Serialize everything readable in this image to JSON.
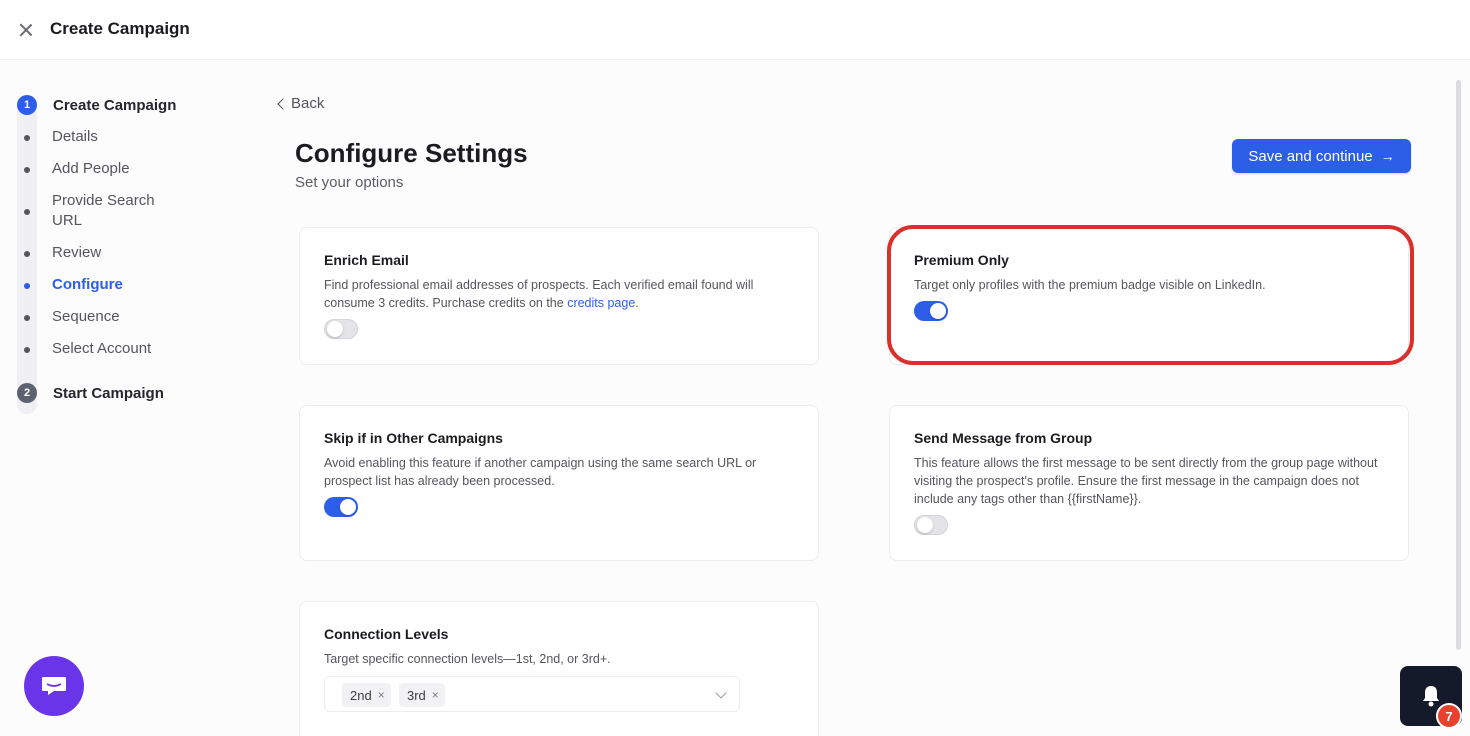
{
  "header": {
    "title": "Create Campaign"
  },
  "stepper": {
    "step1": {
      "number": "1",
      "label": "Create Campaign"
    },
    "step2": {
      "number": "2",
      "label": "Start Campaign"
    },
    "substeps": [
      {
        "label": "Details"
      },
      {
        "label": "Add People"
      },
      {
        "label": "Provide Search URL"
      },
      {
        "label": "Review"
      },
      {
        "label": "Configure"
      },
      {
        "label": "Sequence"
      },
      {
        "label": "Select Account"
      }
    ],
    "current_substep": "Configure"
  },
  "main": {
    "back_label": "Back",
    "title": "Configure Settings",
    "subtitle": "Set your options",
    "save_button_label": "Save and continue",
    "arrow_glyph": "→"
  },
  "cards": {
    "enrich_email": {
      "title": "Enrich Email",
      "desc_prefix": "Find professional email addresses of prospects. Each verified email found will consume 3 credits. Purchase credits on the ",
      "link_text": "credits page",
      "desc_suffix": ".",
      "enabled": false
    },
    "premium_only": {
      "title": "Premium Only",
      "desc": "Target only profiles with the premium badge visible on LinkedIn.",
      "enabled": true,
      "highlighted": true
    },
    "skip_other_campaigns": {
      "title": "Skip if in Other Campaigns",
      "desc": "Avoid enabling this feature if another campaign using the same search URL or prospect list has already been processed.",
      "enabled": true
    },
    "send_from_group": {
      "title": "Send Message from Group",
      "desc": "This feature allows the first message to be sent directly from the group page without visiting the prospect's profile. Ensure the first message in the campaign does not include any tags other than {{firstName}}.",
      "enabled": false
    },
    "connection_levels": {
      "title": "Connection Levels",
      "desc": "Target specific connection levels—1st, 2nd, or 3rd+.",
      "selected": [
        "2nd",
        "3rd"
      ],
      "remove_glyph": "×"
    }
  },
  "widgets": {
    "notification_count": "7"
  },
  "colors": {
    "accent": "#2d5ee8",
    "highlight": "#d9302c",
    "chat": "#6a35e8",
    "badge": "#e8412e"
  }
}
